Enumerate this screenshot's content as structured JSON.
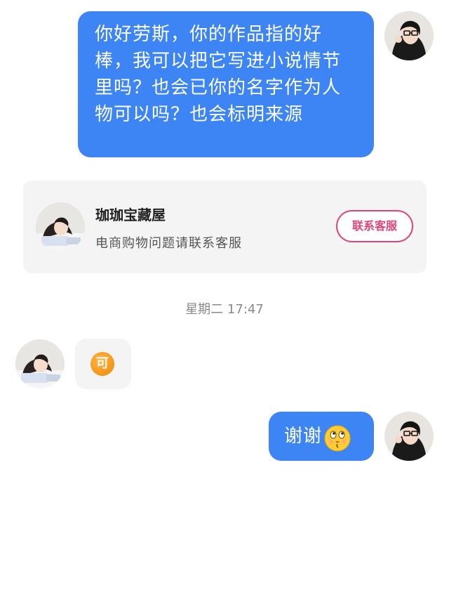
{
  "messages": [
    {
      "direction": "outgoing",
      "text": "你好劳斯，你的作品指的好棒，我可以把它写进小说情节里吗？也会已你的名字作为人物可以吗？也会标明来源"
    },
    {
      "direction": "incoming",
      "text": "可"
    },
    {
      "direction": "outgoing",
      "text": "谢谢",
      "emoji": "kissing-face-emoji"
    }
  ],
  "shop_card": {
    "name": "珈珈宝藏屋",
    "subtitle": "电商购物问题请联系客服",
    "contact_button_label": "联系客服"
  },
  "timestamp": "星期二 17:47",
  "colors": {
    "outgoing_bubble": "#3d84f5",
    "incoming_bubble": "#f4f4f5",
    "contact_accent": "#e0457a",
    "ok_badge": "#f08a00"
  },
  "icons": {
    "self_avatar": "avatar-self",
    "shop_avatar": "avatar-shop",
    "ok_badge": "ok-badge-icon"
  }
}
